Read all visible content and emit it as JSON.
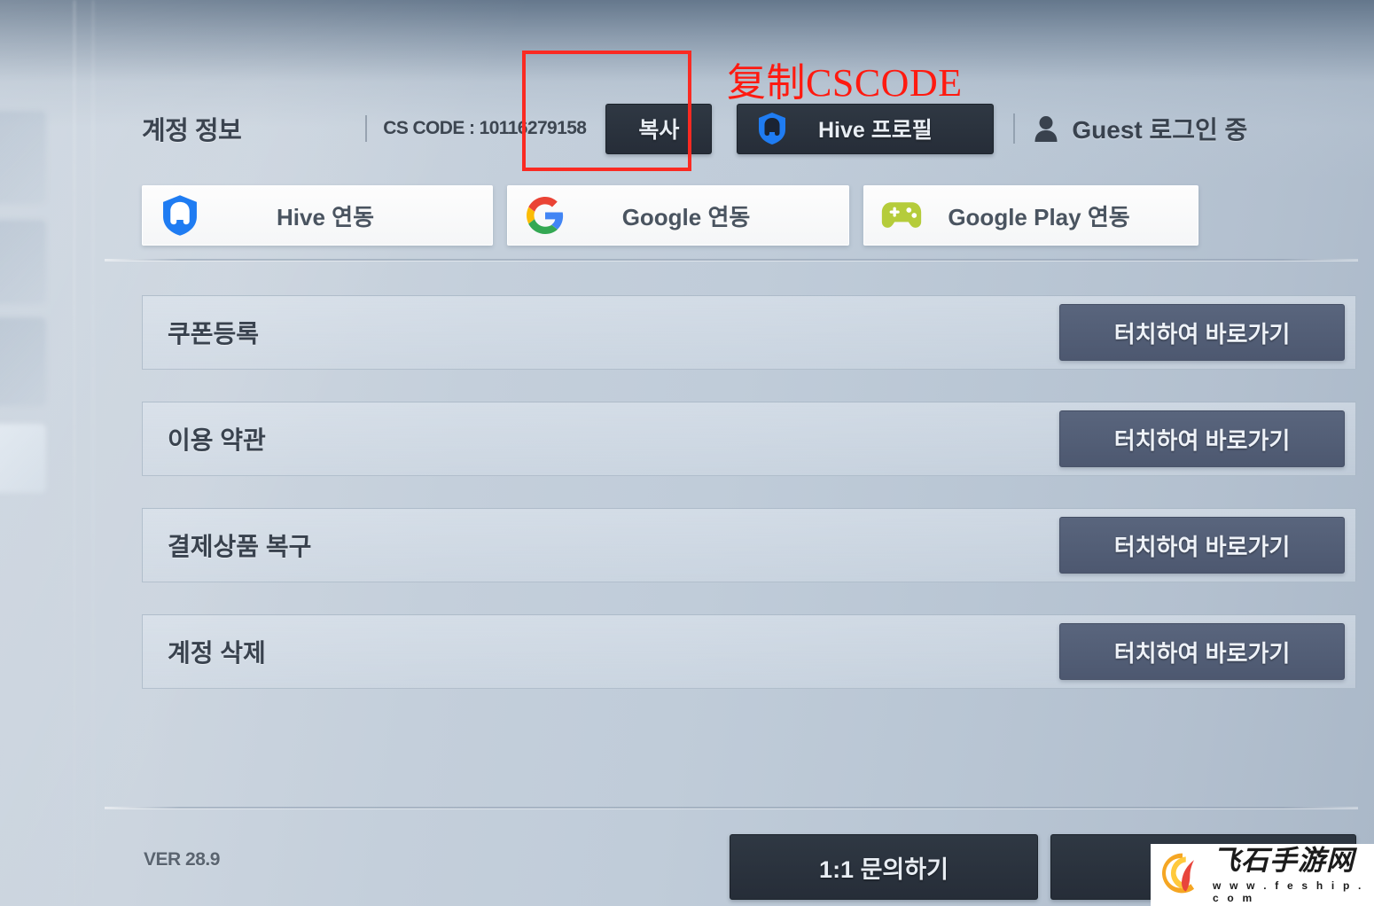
{
  "header": {
    "page_title": "계정 정보",
    "cs_code_label": "CS CODE :",
    "cs_code_value": "10116279158",
    "copy_button": "복사",
    "hive_profile_button": "Hive 프로필",
    "login_status": "Guest 로그인 중",
    "person_icon": "person-icon",
    "hive_shield_icon": "hive-shield-icon"
  },
  "link_buttons": [
    {
      "label": "Hive 연동",
      "icon": "hive-shield-icon"
    },
    {
      "label": "Google 연동",
      "icon": "google-g-icon"
    },
    {
      "label": "Google Play 연동",
      "icon": "google-play-gamepad-icon"
    }
  ],
  "menu_rows": [
    {
      "label": "쿠폰등록",
      "action": "터치하여 바로가기"
    },
    {
      "label": "이용 약관",
      "action": "터치하여 바로가기"
    },
    {
      "label": "결제상품 복구",
      "action": "터치하여 바로가기"
    },
    {
      "label": "계정 삭제",
      "action": "터치하여 바로가기"
    }
  ],
  "footer": {
    "version": "VER 28.9",
    "inquiry_button": "1:1 문의하기",
    "extra_button": ""
  },
  "annotation": {
    "note_text": "复制CSCODE",
    "highlight_color": "#fa2a22",
    "note_color": "#ff1a10"
  },
  "watermark": {
    "title": "飞石手游网",
    "url": "w w w . f e s h i p . c o m",
    "logo_icon": "feship-swoosh-logo-icon"
  },
  "colors": {
    "dark_button": "#2f3843",
    "slate_button": "#59657d",
    "page_bg": "#c4cfdb",
    "text_primary": "#39424e",
    "hive_blue": "#1f7cf2",
    "gplay_green": "#b5cc3b"
  }
}
